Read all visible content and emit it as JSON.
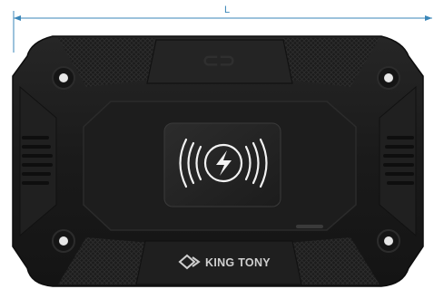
{
  "dimension": {
    "label": "L"
  },
  "device": {
    "brand_name": "KING TONY",
    "charging_pad_icon": "wireless-charging-bolt-icon",
    "body_color": "#1b1b1b",
    "accent_color": "#3a86b8"
  }
}
